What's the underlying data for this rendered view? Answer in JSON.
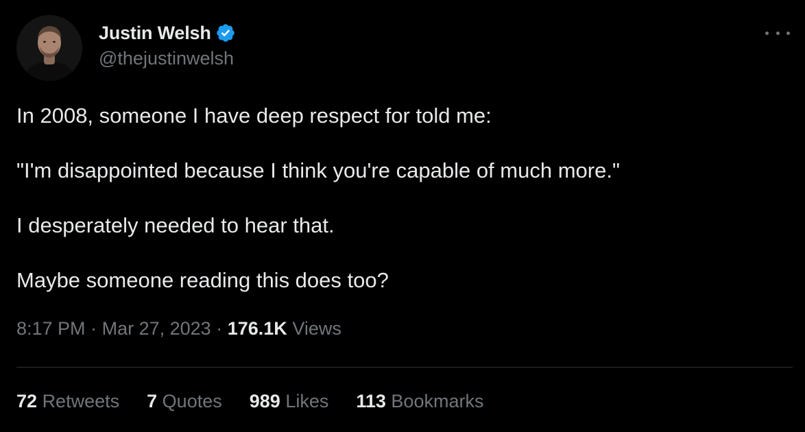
{
  "author": {
    "display_name": "Justin Welsh",
    "handle": "@thejustinwelsh",
    "verified": true,
    "verified_color": "#1d9bf0"
  },
  "tweet": {
    "paragraphs": [
      "In 2008, someone I have deep respect for told me:",
      "\"I'm disappointed because I think you're capable of much more.\"",
      "I desperately needed to hear that.",
      "Maybe someone reading this does too?"
    ],
    "time": "8:17 PM",
    "date": "Mar 27, 2023",
    "views_count": "176.1K",
    "views_label": "Views",
    "separator": "·"
  },
  "stats": {
    "retweets": {
      "count": "72",
      "label": "Retweets"
    },
    "quotes": {
      "count": "7",
      "label": "Quotes"
    },
    "likes": {
      "count": "989",
      "label": "Likes"
    },
    "bookmarks": {
      "count": "113",
      "label": "Bookmarks"
    }
  },
  "icons": {
    "more": "more-horizontal-icon",
    "verified": "verified-badge-icon"
  },
  "colors": {
    "background": "#000000",
    "primary_text": "#e7e9ea",
    "secondary_text": "#71767b",
    "divider": "#2f3336"
  }
}
